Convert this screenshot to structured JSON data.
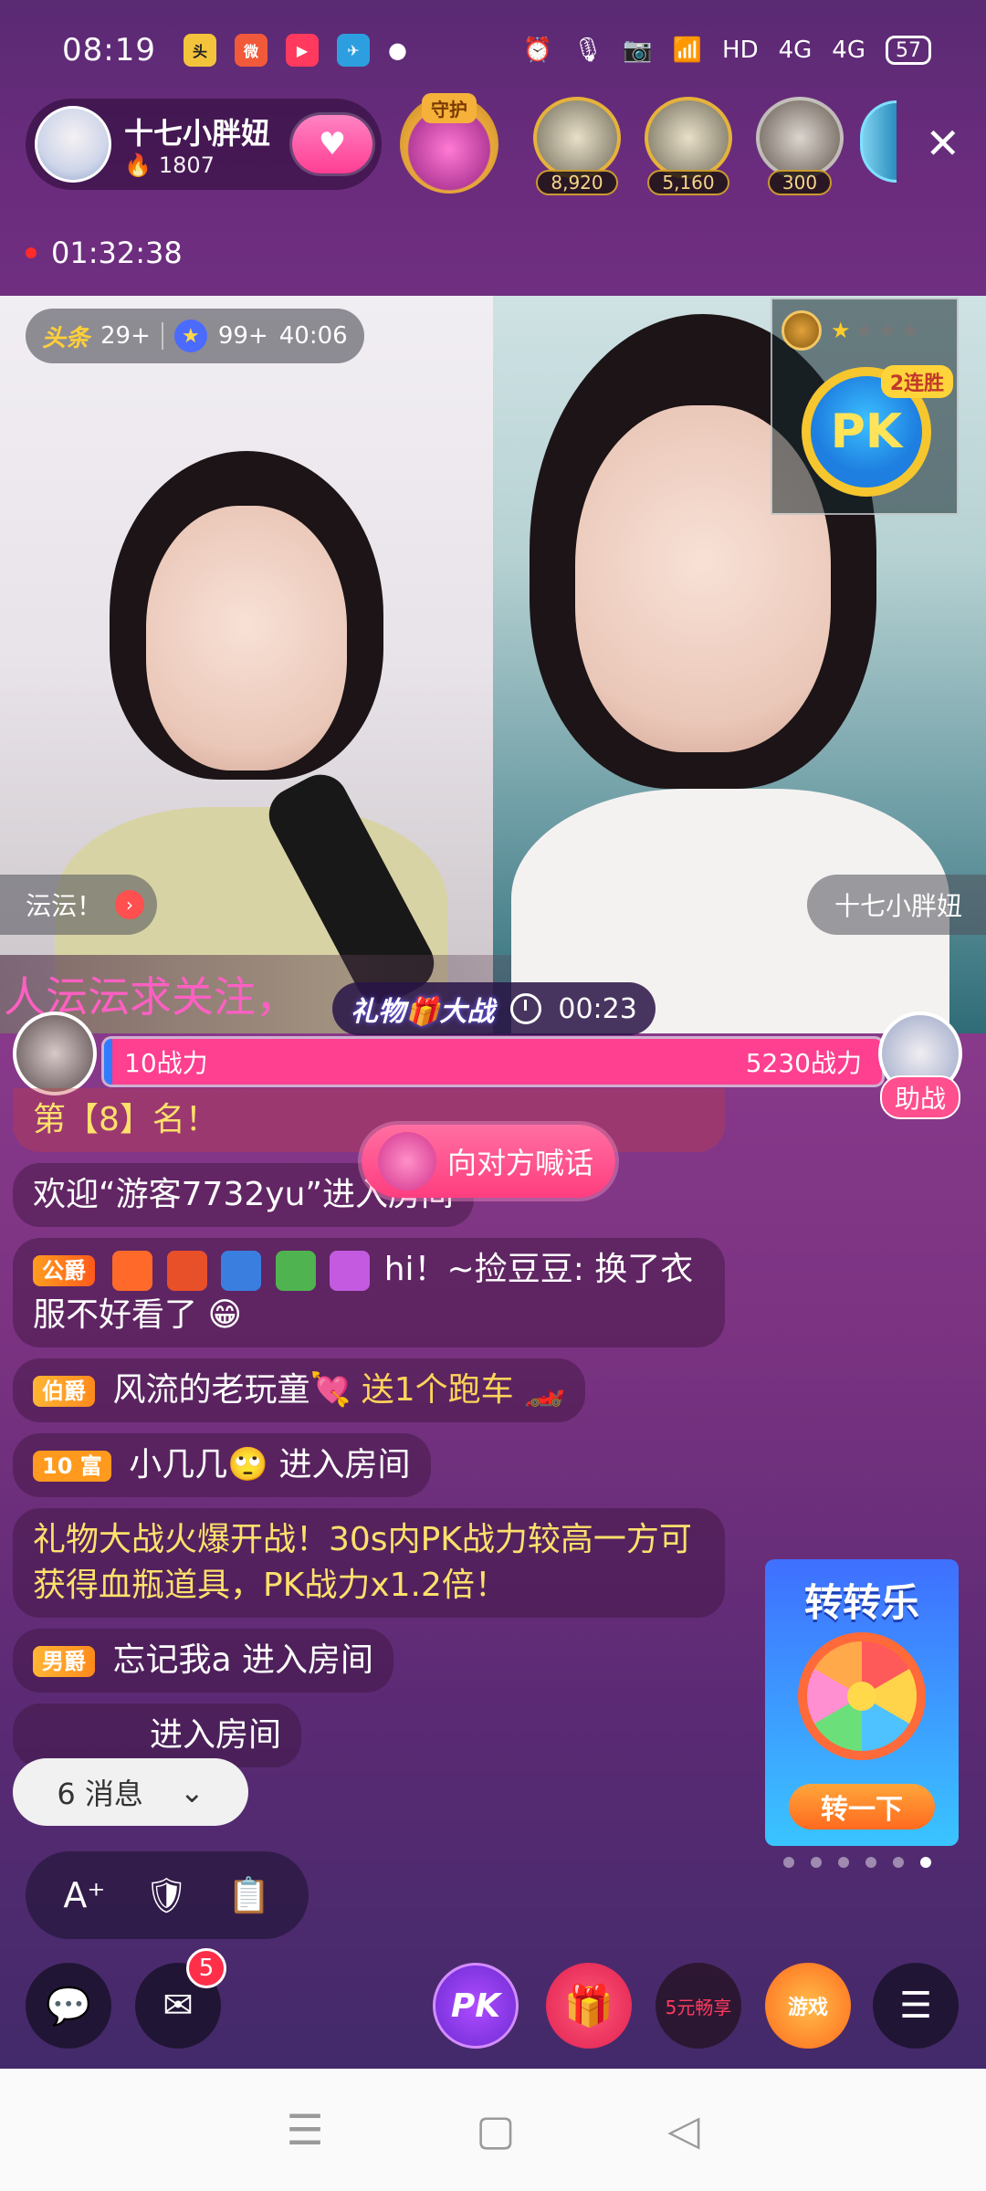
{
  "status_bar": {
    "time": "08:19",
    "indicators": [
      "HD",
      "4G",
      "4G"
    ],
    "battery": "57"
  },
  "host": {
    "name": "十七小胖妞",
    "heat": "1807"
  },
  "guard_label": "守护",
  "ranking": [
    {
      "score": "8,920"
    },
    {
      "score": "5,160"
    },
    {
      "score": "300"
    }
  ],
  "live_timer": "01:32:38",
  "stage": {
    "chip_tag": "头条",
    "chip_count": "29+",
    "chip_star_count": "99+",
    "chip_time": "40:06",
    "left_name": "沄沄！",
    "right_name": "十七小胖妞",
    "pk_streak": "2连胜",
    "pk_coin": "PK",
    "marquee": "人沄沄求关注，",
    "gift_battle_title": "礼物🎁大战",
    "gift_battle_timer": "00:23"
  },
  "pk": {
    "left_power": "10战力",
    "right_power": "5230战力",
    "assist_label": "助战"
  },
  "chat": {
    "rank_msg": "第【8】名！",
    "welcome_msg": "欢迎“游客7732yu”进入房间",
    "msg1_badge": "公爵",
    "msg1_text": "hi！~捡豆豆: 换了衣服不好看了 😁",
    "msg2_badge": "伯爵",
    "msg2_user": "风流的老玩童💘",
    "msg2_action": "送1个跑车 🏎️",
    "msg3_badge": "10 富",
    "msg3_user": "小几几🙄",
    "msg3_action": "进入房间",
    "msg4_text": "礼物大战火爆开战！30s内PK战力较高一方可获得血瓶道具，PK战力x1.2倍！",
    "msg5_badge": "男爵",
    "msg5_user": "忘记我a",
    "msg5_action": "进入房间",
    "msg6_action": "进入房间"
  },
  "shout_label": "向对方喊话",
  "new_msg_pill": "6 消息",
  "promo": {
    "title": "转转乐",
    "button": "转一下"
  },
  "bottom": {
    "mail_badge": "5",
    "pk_label": "PK",
    "coupon_label": "5元畅享",
    "game_label": "游戏"
  }
}
